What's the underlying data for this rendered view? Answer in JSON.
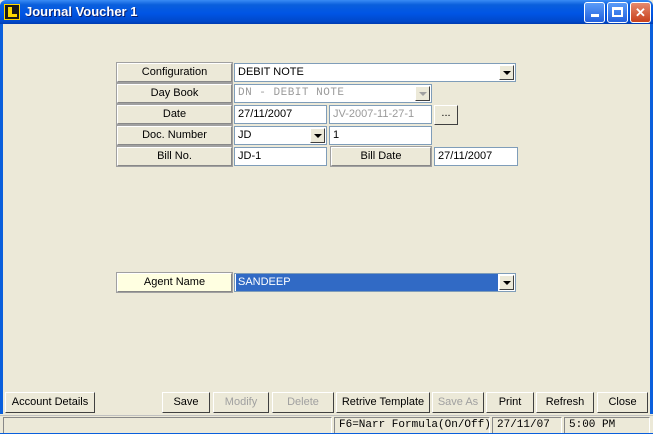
{
  "window": {
    "title": "Journal Voucher 1",
    "title_bar_buttons": [
      "minimize-icon",
      "maximize-icon",
      "close-icon"
    ]
  },
  "form": {
    "configuration": {
      "label": "Configuration",
      "value": "DEBIT NOTE"
    },
    "day_book": {
      "label": "Day Book",
      "value": "DN - DEBIT NOTE"
    },
    "date": {
      "label": "Date",
      "value": "27/11/2007",
      "voucher_ref": "JV-2007-11-27-1",
      "more_button": "..."
    },
    "doc_number": {
      "label": "Doc. Number",
      "prefix": "JD",
      "number": "1"
    },
    "bill_no": {
      "label": "Bill No.",
      "value": "JD-1"
    },
    "bill_date": {
      "label": "Bill Date",
      "value": "27/11/2007"
    },
    "agent_name": {
      "label": "Agent Name",
      "value": "SANDEEP"
    }
  },
  "buttons": {
    "account_details": "Account Details",
    "save": "Save",
    "modify": "Modify",
    "delete": "Delete",
    "retrieve_template": "Retrive Template",
    "save_as": "Save As",
    "print": "Print",
    "refresh": "Refresh",
    "close": "Close"
  },
  "status": {
    "formula_hint": "F6=Narr Formula(On/Off)",
    "date": "27/11/07",
    "time": "5:00 PM"
  },
  "colors": {
    "title_bar": "#0055e5",
    "selection": "#316ac5",
    "agent_label_bg": "#ffffe1",
    "window_bg": "#ece9d8"
  }
}
